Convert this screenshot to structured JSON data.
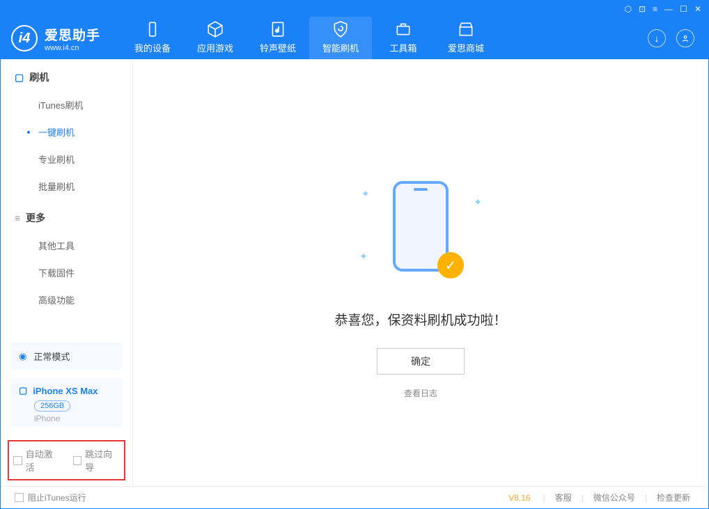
{
  "brand": {
    "name": "爱思助手",
    "url": "www.i4.cn"
  },
  "nav": {
    "items": [
      {
        "label": "我的设备"
      },
      {
        "label": "应用游戏"
      },
      {
        "label": "铃声壁纸"
      },
      {
        "label": "智能刷机"
      },
      {
        "label": "工具箱"
      },
      {
        "label": "爱思商城"
      }
    ]
  },
  "sidebar": {
    "section1": "刷机",
    "items1": [
      {
        "label": "iTunes刷机"
      },
      {
        "label": "一键刷机"
      },
      {
        "label": "专业刷机"
      },
      {
        "label": "批量刷机"
      }
    ],
    "section2": "更多",
    "items2": [
      {
        "label": "其他工具"
      },
      {
        "label": "下载固件"
      },
      {
        "label": "高级功能"
      }
    ],
    "mode": "正常模式",
    "device": {
      "name": "iPhone XS Max",
      "storage": "256GB",
      "type": "iPhone"
    },
    "checkboxes": {
      "auto_activate": "自动激活",
      "skip_guide": "跳过向导"
    }
  },
  "main": {
    "success_msg": "恭喜您，保资料刷机成功啦！",
    "ok_btn": "确定",
    "log_link": "查看日志"
  },
  "footer": {
    "block_itunes": "阻止iTunes运行",
    "version": "V8.16",
    "links": {
      "cs": "客服",
      "wechat": "微信公众号",
      "update": "检查更新"
    }
  }
}
